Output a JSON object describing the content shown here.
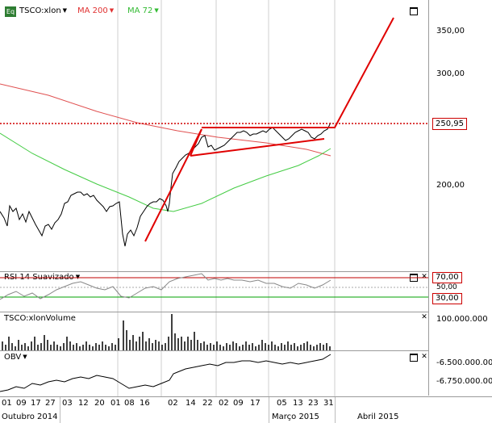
{
  "chart": {
    "symbol_icon_text": "Eq",
    "symbol": "TSCO:xlon",
    "ma200_label": "MA 200",
    "ma72_label": "MA 72",
    "price_ticks": [
      "350,00",
      "300,00",
      "250,95",
      "200,00"
    ],
    "last_price": "250,95"
  },
  "rsi": {
    "label": "RSI 14 Suavizado",
    "upper": "70,00",
    "mid": "50,00",
    "lower": "30,00"
  },
  "volume": {
    "label": "TSCO:xlonVolume",
    "tick": "100.000.000"
  },
  "obv": {
    "label": "OBV",
    "ticks": [
      "-6.500.000.000",
      "-6.750.000.000"
    ]
  },
  "xaxis": {
    "days": [
      "01",
      "09",
      "17",
      "27",
      "03",
      "12",
      "20",
      "01",
      "08",
      "16",
      "02",
      "14",
      "22",
      "02",
      "09",
      "17",
      "05",
      "13",
      "23",
      "31"
    ],
    "months": [
      "Outubro 2014",
      "Março 2015",
      "Abril 2015"
    ]
  },
  "colors": {
    "price_line": "#e00000",
    "ma200": "#e05050",
    "ma72": "#44cc44",
    "rsi_line": "#888888"
  }
}
